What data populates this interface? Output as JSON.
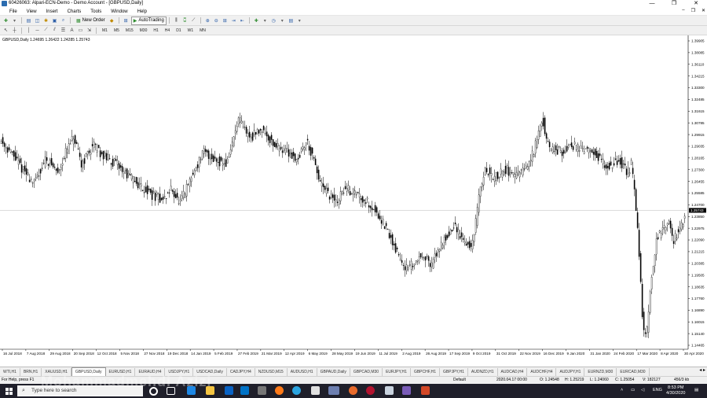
{
  "app": {
    "title": "60426063: Alpari-ECN-Demo - Demo Account - [GBPUSD,Daily]",
    "window_buttons": [
      "—",
      "❐",
      "✕"
    ],
    "mdi_buttons": [
      "–",
      "❐",
      "✕"
    ]
  },
  "menu": [
    "File",
    "View",
    "Insert",
    "Charts",
    "Tools",
    "Window",
    "Help"
  ],
  "toolbar": {
    "new_order": "New Order",
    "autotrading": "AutoTrading",
    "timeframes": [
      "M1",
      "M5",
      "M15",
      "M30",
      "H1",
      "H4",
      "D1",
      "W1",
      "MN"
    ]
  },
  "chart": {
    "symbol_label": "GBPUSD,Daily  1.24695 1.26422 1.24285 1.25743",
    "current_price": "1.25743",
    "price_labels": [
      "1.39905",
      "1.38085",
      "1.36110",
      "1.34215",
      "1.33300",
      "1.32485",
      "1.31615",
      "1.30785",
      "1.29915",
      "1.29035",
      "1.28165",
      "1.27300",
      "1.26455",
      "1.25585",
      "1.24700",
      "1.23850",
      "1.22975",
      "1.22090",
      "1.21215",
      "1.20385",
      "1.19505",
      "1.18635",
      "1.17760",
      "1.16890",
      "1.16015",
      "1.15140",
      "1.14465"
    ],
    "date_labels": [
      "16 Jul 2018",
      "7 Aug 2018",
      "29 Aug 2018",
      "20 Sep 2018",
      "12 Oct 2018",
      "5 Nov 2018",
      "27 Nov 2018",
      "19 Dec 2018",
      "14 Jan 2019",
      "5 Feb 2019",
      "27 Feb 2019",
      "21 Mar 2019",
      "12 Apr 2019",
      "6 May 2019",
      "28 May 2019",
      "19 Jun 2019",
      "11 Jul 2019",
      "2 Aug 2019",
      "26 Aug 2019",
      "17 Sep 2019",
      "9 Oct 2019",
      "31 Oct 2019",
      "22 Nov 2019",
      "16 Dec 2019",
      "9 Jan 2020",
      "31 Jan 2020",
      "24 Feb 2020",
      "17 Mar 2020",
      "8 Apr 2020",
      "30 Apr 2020"
    ],
    "colors": {
      "candle": "#000000",
      "price_line": "#c8c8c8",
      "price_tag_bg": "#000000"
    }
  },
  "tabs": [
    "WTI,H1",
    "BRN,H1",
    "XAUUSD,H1",
    "GBPUSD,Daily",
    "EURUSD,H1",
    "EURAUD,H4",
    "USDJPY,H1",
    "USDCAD,Daily",
    "CADJPY,H4",
    "NZDUSD,M15",
    "AUDUSD,H1",
    "GBPAUD,Daily",
    "GBPCAD,M30",
    "EURJPY,H1",
    "GBPCHF,H1",
    "GBPJPY,H1",
    "AUDNZD,H1",
    "AUDCAD,H4",
    "AUDCHF,H4",
    "AUDJPY,H1",
    "EURNZD,M30",
    "EURCAD,M30"
  ],
  "active_tab": "GBPUSD,Daily",
  "status": {
    "help": "For Help, press F1",
    "profile": "Default",
    "datetime": "2020.04.17 00:00",
    "open": "O: 1.24548",
    "high": "H: 1.25219",
    "low": "L: 1.24060",
    "close": "C: 1.25054",
    "volume": "V: 182127",
    "traffic": "456/3 kb"
  },
  "taskbar": {
    "search_placeholder": "Type here to search",
    "lang": "ENG",
    "time": "8:53 PM",
    "date": "4/30/2020"
  },
  "watermark": "Mohammadmehdi Azizi"
}
